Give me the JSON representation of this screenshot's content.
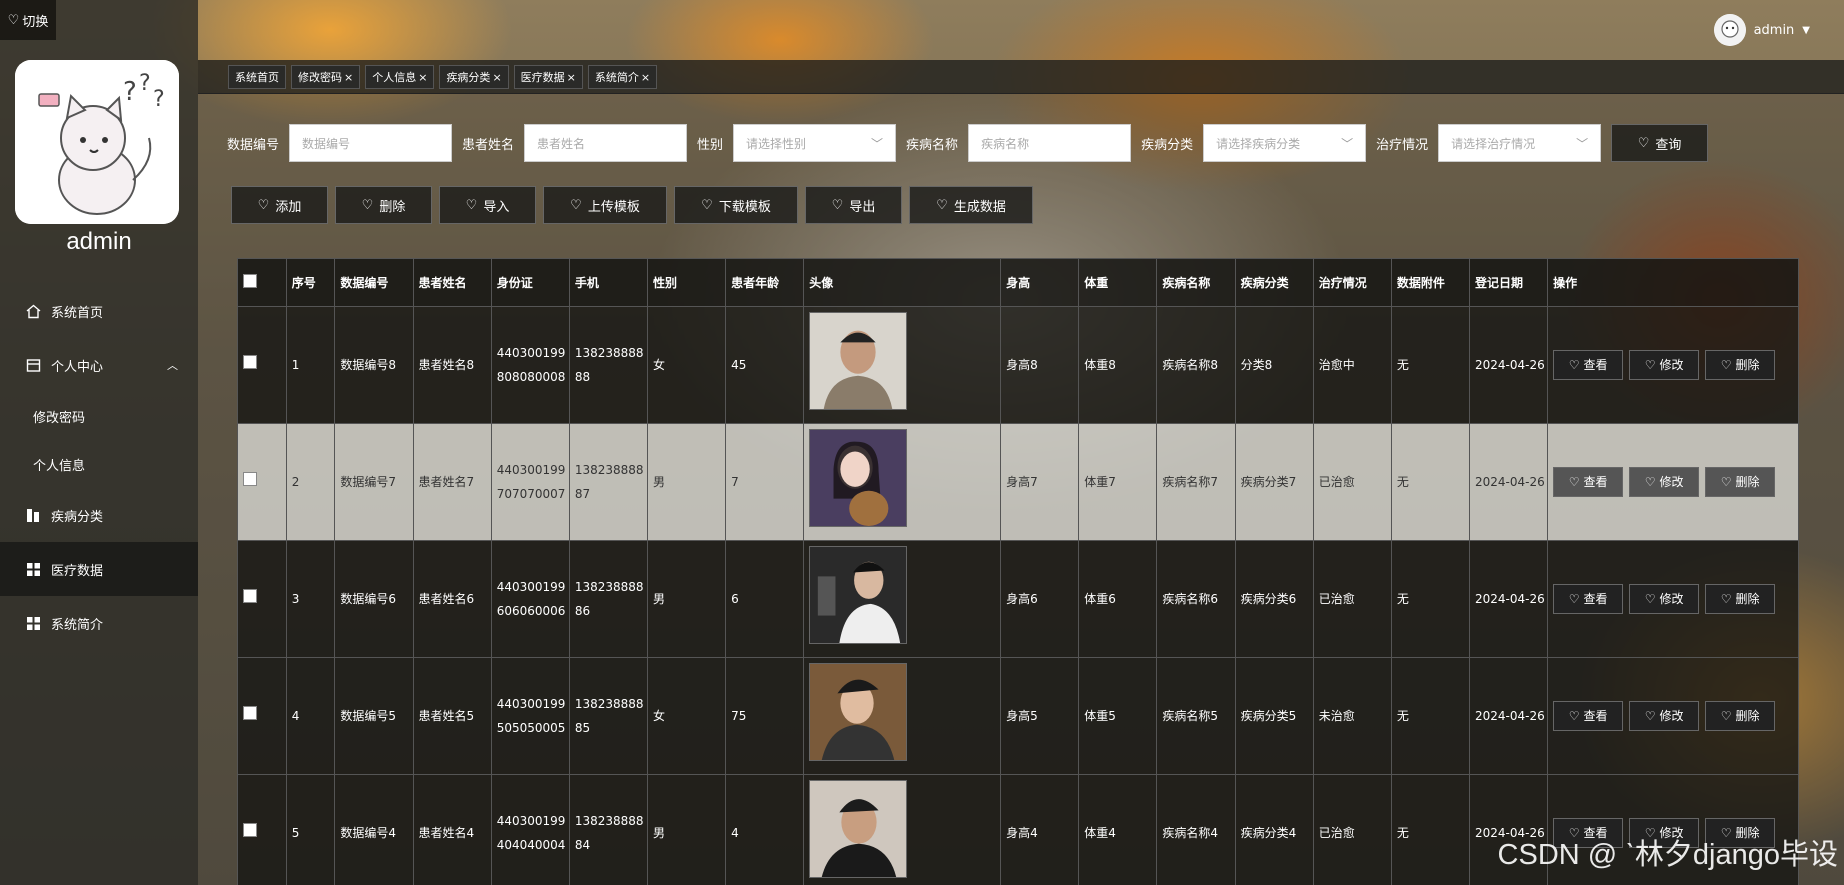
{
  "sidebar": {
    "switch_label": "切换",
    "admin_name": "admin",
    "items": [
      {
        "label": "系统首页",
        "icon": "home-icon"
      },
      {
        "label": "个人中心",
        "icon": "calendar-icon"
      },
      {
        "label": "修改密码"
      },
      {
        "label": "个人信息"
      },
      {
        "label": "疾病分类",
        "icon": "chart-icon"
      },
      {
        "label": "医疗数据",
        "icon": "grid-icon"
      },
      {
        "label": "系统简介",
        "icon": "grid-icon"
      }
    ]
  },
  "header": {
    "user": "admin",
    "tabs": [
      "系统首页",
      "修改密码",
      "个人信息",
      "疾病分类",
      "医疗数据",
      "系统简介"
    ]
  },
  "search": {
    "data_no_label": "数据编号",
    "data_no_placeholder": "数据编号",
    "name_label": "患者姓名",
    "name_placeholder": "患者姓名",
    "gender_label": "性别",
    "gender_placeholder": "请选择性别",
    "disease_label": "疾病名称",
    "disease_placeholder": "疾病名称",
    "category_label": "疾病分类",
    "category_placeholder": "请选择疾病分类",
    "treatment_label": "治疗情况",
    "treatment_placeholder": "请选择治疗情况",
    "query_btn": "查询"
  },
  "actions": [
    "添加",
    "删除",
    "导入",
    "上传模板",
    "下载模板",
    "导出",
    "生成数据"
  ],
  "table": {
    "headers": [
      "序号",
      "数据编号",
      "患者姓名",
      "身份证",
      "手机",
      "性别",
      "患者年龄",
      "头像",
      "身高",
      "体重",
      "疾病名称",
      "疾病分类",
      "治疗情况",
      "数据附件",
      "登记日期",
      "操作"
    ],
    "row_buttons": [
      "查看",
      "修改",
      "删除"
    ],
    "rows": [
      {
        "no": "1",
        "data_no": "数据编号8",
        "name": "患者姓名8",
        "id": "440300199808080008",
        "phone": "13823888888",
        "gender": "女",
        "age": "45",
        "height": "身高8",
        "weight": "体重8",
        "disease": "疾病名称8",
        "category": "分类8",
        "treatment": "治愈中",
        "attach": "无",
        "date": "2024-04-26"
      },
      {
        "no": "2",
        "data_no": "数据编号7",
        "name": "患者姓名7",
        "id": "440300199707070007",
        "phone": "13823888887",
        "gender": "男",
        "age": "7",
        "height": "身高7",
        "weight": "体重7",
        "disease": "疾病名称7",
        "category": "疾病分类7",
        "treatment": "已治愈",
        "attach": "无",
        "date": "2024-04-26"
      },
      {
        "no": "3",
        "data_no": "数据编号6",
        "name": "患者姓名6",
        "id": "440300199606060006",
        "phone": "13823888886",
        "gender": "男",
        "age": "6",
        "height": "身高6",
        "weight": "体重6",
        "disease": "疾病名称6",
        "category": "疾病分类6",
        "treatment": "已治愈",
        "attach": "无",
        "date": "2024-04-26"
      },
      {
        "no": "4",
        "data_no": "数据编号5",
        "name": "患者姓名5",
        "id": "440300199505050005",
        "phone": "13823888885",
        "gender": "女",
        "age": "75",
        "height": "身高5",
        "weight": "体重5",
        "disease": "疾病名称5",
        "category": "疾病分类5",
        "treatment": "未治愈",
        "attach": "无",
        "date": "2024-04-26"
      },
      {
        "no": "5",
        "data_no": "数据编号4",
        "name": "患者姓名4",
        "id": "440300199404040004",
        "phone": "13823888884",
        "gender": "男",
        "age": "4",
        "height": "身高4",
        "weight": "体重4",
        "disease": "疾病名称4",
        "category": "疾病分类4",
        "treatment": "已治愈",
        "attach": "无",
        "date": "2024-04-26"
      }
    ]
  },
  "watermark": "CSDN @ ˋ林夕django毕设"
}
